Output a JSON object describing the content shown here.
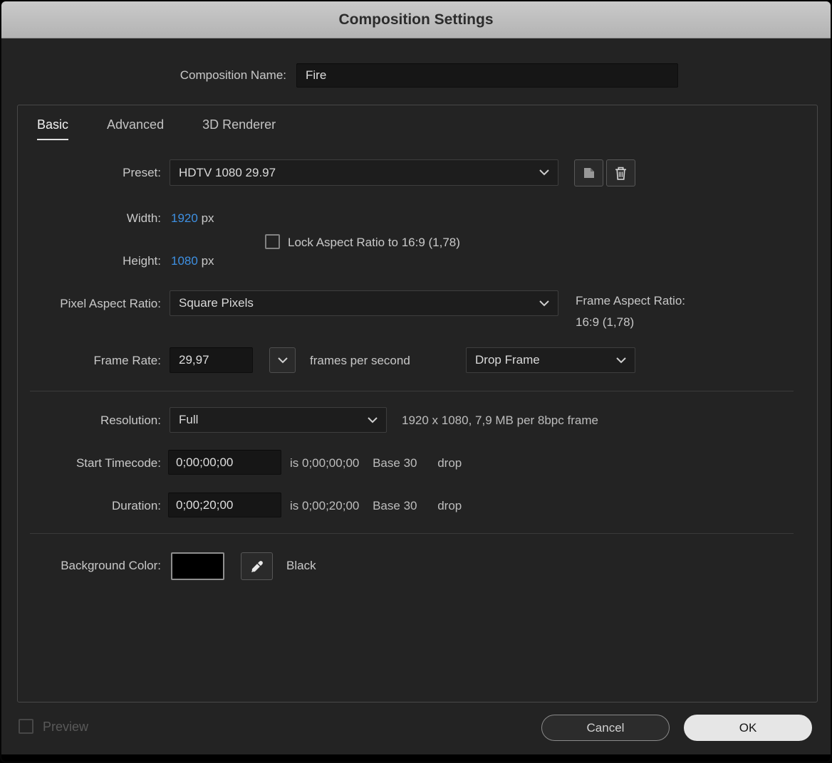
{
  "window": {
    "title": "Composition Settings"
  },
  "composition_name": {
    "label": "Composition Name:",
    "value": "Fire"
  },
  "tabs": [
    {
      "label": "Basic",
      "active": true
    },
    {
      "label": "Advanced",
      "active": false
    },
    {
      "label": "3D Renderer",
      "active": false
    }
  ],
  "preset": {
    "label": "Preset:",
    "value": "HDTV 1080 29.97"
  },
  "width": {
    "label": "Width:",
    "value": "1920",
    "unit": "px"
  },
  "height": {
    "label": "Height:",
    "value": "1080",
    "unit": "px"
  },
  "lock_aspect_ratio": {
    "label": "Lock Aspect Ratio to 16:9 (1,78)",
    "checked": false
  },
  "pixel_aspect_ratio": {
    "label": "Pixel Aspect Ratio:",
    "value": "Square Pixels"
  },
  "frame_aspect_ratio": {
    "label": "Frame Aspect Ratio:",
    "value": "16:9 (1,78)"
  },
  "frame_rate": {
    "label": "Frame Rate:",
    "value": "29,97",
    "units": "frames per second",
    "drop_mode": "Drop Frame"
  },
  "resolution": {
    "label": "Resolution:",
    "value": "Full",
    "info": "1920 x 1080, 7,9 MB per 8bpc frame"
  },
  "start_timecode": {
    "label": "Start Timecode:",
    "value": "0;00;00;00",
    "is_text": "is 0;00;00;00",
    "base_text": "Base 30",
    "drop_text": "drop"
  },
  "duration": {
    "label": "Duration:",
    "value": "0;00;20;00",
    "is_text": "is 0;00;20;00",
    "base_text": "Base 30",
    "drop_text": "drop"
  },
  "background_color": {
    "label": "Background Color:",
    "color_name": "Black",
    "swatch_hex": "#000000"
  },
  "footer": {
    "preview_label": "Preview",
    "preview_checked": false,
    "cancel_label": "Cancel",
    "ok_label": "OK"
  },
  "icons": {
    "save_preset": "folded-page-icon",
    "delete_preset": "trash-icon",
    "dropdown": "chevron-down-icon",
    "background_eyedropper": "eyedropper-icon"
  },
  "colors": {
    "accent_value_blue": "#3e90e2",
    "dialog_bg": "#232323",
    "titlebar_text": "#2c2c2c",
    "swatch": "#000000"
  }
}
